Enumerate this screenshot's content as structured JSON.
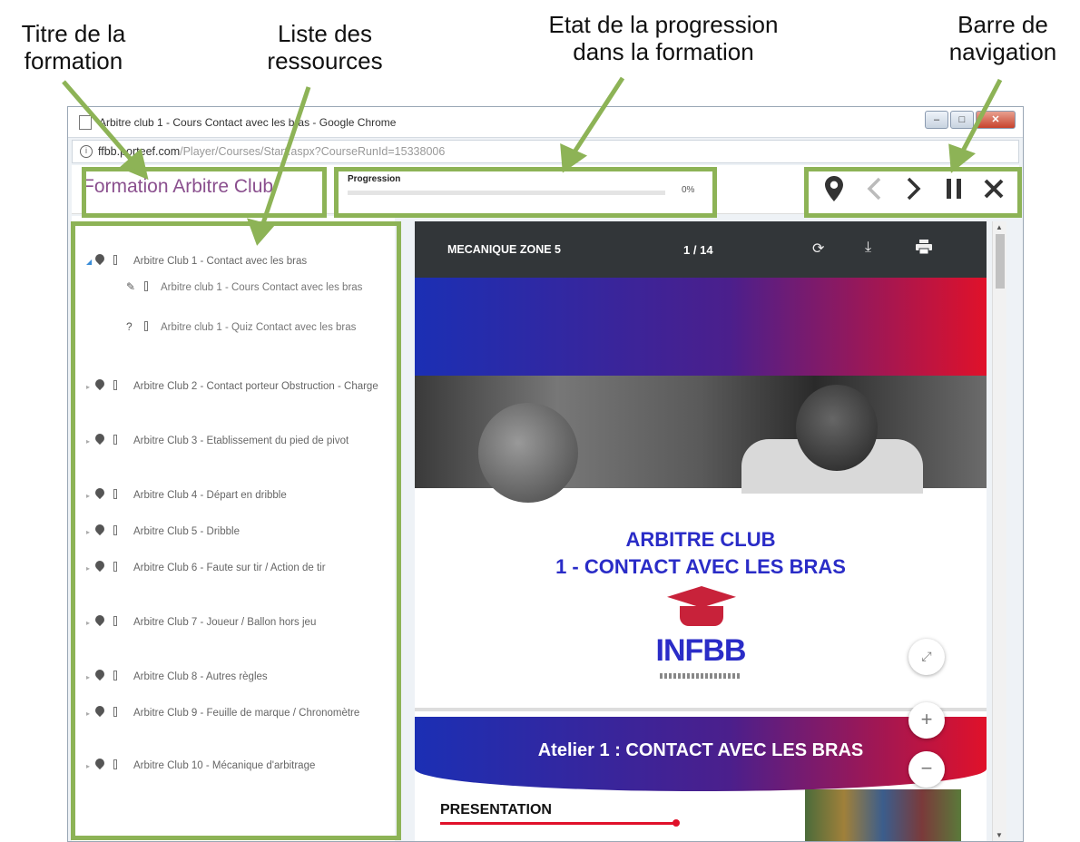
{
  "callouts": {
    "course_title": "Titre de la\nformation",
    "resources": "Liste des\nressources",
    "progress": "Etat de la progression\ndans la formation",
    "navigation": "Barre de\nnavigation"
  },
  "window": {
    "title": "Arbitre club 1 - Cours Contact avec les bras - Google Chrome",
    "url_host": "ffbb.porteef.com",
    "url_path": "/Player/Courses/Start.aspx?CourseRunId=15338006"
  },
  "header": {
    "course_title": "Formation Arbitre Club",
    "progress_label": "Progression",
    "progress_value": 0,
    "progress_text": "0%"
  },
  "colors": {
    "callout_green": "#8db356",
    "brand_purple": "#8a4f8e",
    "slide_blue": "#2a2cc7",
    "slide_red": "#e0112a"
  },
  "sidebar": {
    "items": [
      {
        "label": "Arbitre Club 1 - Contact avec les bras",
        "expanded": true
      },
      {
        "label": "Arbitre Club 2 - Contact porteur Obstruction - Charge"
      },
      {
        "label": "Arbitre Club 3 - Etablissement du pied de pivot"
      },
      {
        "label": "Arbitre Club 4 - Départ en dribble"
      },
      {
        "label": "Arbitre Club 5 - Dribble"
      },
      {
        "label": "Arbitre Club 6 - Faute sur tir / Action de tir"
      },
      {
        "label": "Arbitre Club 7 - Joueur / Ballon hors jeu"
      },
      {
        "label": "Arbitre Club 8 - Autres règles"
      },
      {
        "label": "Arbitre Club 9 - Feuille de marque / Chronomètre"
      },
      {
        "label": "Arbitre Club 10 - Mécanique d'arbitrage"
      }
    ],
    "subitems": [
      {
        "label": "Arbitre club 1 - Cours Contact avec les bras",
        "icon": "paperclip-icon"
      },
      {
        "label": "Arbitre club 1 - Quiz Contact avec les bras",
        "icon": "question-icon"
      }
    ]
  },
  "viewer": {
    "doc_name": "MECANIQUE ZONE 5",
    "page_current": "1",
    "page_sep": "/",
    "page_total": "14",
    "slide_title_line1": "ARBITRE CLUB",
    "slide_title_line2": "1 - CONTACT AVEC LES BRAS",
    "logo_text": "INFBB",
    "atelier": "Atelier 1 : CONTACT AVEC LES BRAS",
    "presentation": "PRESENTATION"
  }
}
